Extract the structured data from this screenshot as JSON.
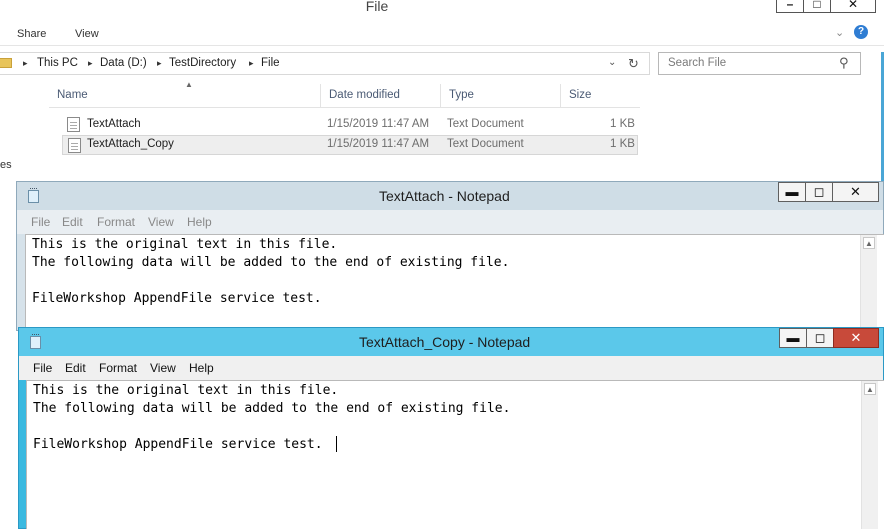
{
  "explorer": {
    "title": "File",
    "window_buttons": {
      "minimize": "–",
      "maximize": "□",
      "close": "✕"
    },
    "ribbon_tabs": [
      "Share",
      "View"
    ],
    "ribbon_expand": "⌄",
    "help": "?",
    "breadcrumb": [
      "This PC",
      "Data (D:)",
      "TestDirectory",
      "File"
    ],
    "breadcrumb_sep": "▸",
    "address_dropdown": "⌄",
    "refresh": "↻",
    "search_placeholder": "Search File",
    "search_icon": "⚲",
    "left_pane_text": "es",
    "columns": [
      "Name",
      "Date modified",
      "Type",
      "Size"
    ],
    "sort_arrow": "▲",
    "files": [
      {
        "name": "TextAttach",
        "date": "1/15/2019 11:47 AM",
        "type": "Text Document",
        "size": "1 KB"
      },
      {
        "name": "TextAttach_Copy",
        "date": "1/15/2019 11:47 AM",
        "type": "Text Document",
        "size": "1 KB"
      }
    ]
  },
  "notepads": [
    {
      "title": "TextAttach - Notepad",
      "menu": [
        "File",
        "Edit",
        "Format",
        "View",
        "Help"
      ],
      "lines": [
        "This is the original text in this file.",
        "The following data will be added to the end of existing file.",
        "",
        "FileWorkshop AppendFile service test."
      ]
    },
    {
      "title": "TextAttach_Copy - Notepad",
      "menu": [
        "File",
        "Edit",
        "Format",
        "View",
        "Help"
      ],
      "lines": [
        "This is the original text in this file.",
        "The following data will be added to the end of existing file.",
        "",
        "FileWorkshop AppendFile service test."
      ]
    }
  ],
  "caption_glyphs": {
    "minimize": "▬",
    "maximize": "◻",
    "close": "✕"
  },
  "scroll_up": "▲",
  "colors": {
    "active_frame": "#3ab9e0",
    "inactive_frame": "#d6e2ea",
    "close_active": "#c84a3a",
    "help_blue": "#2f7dd3"
  }
}
